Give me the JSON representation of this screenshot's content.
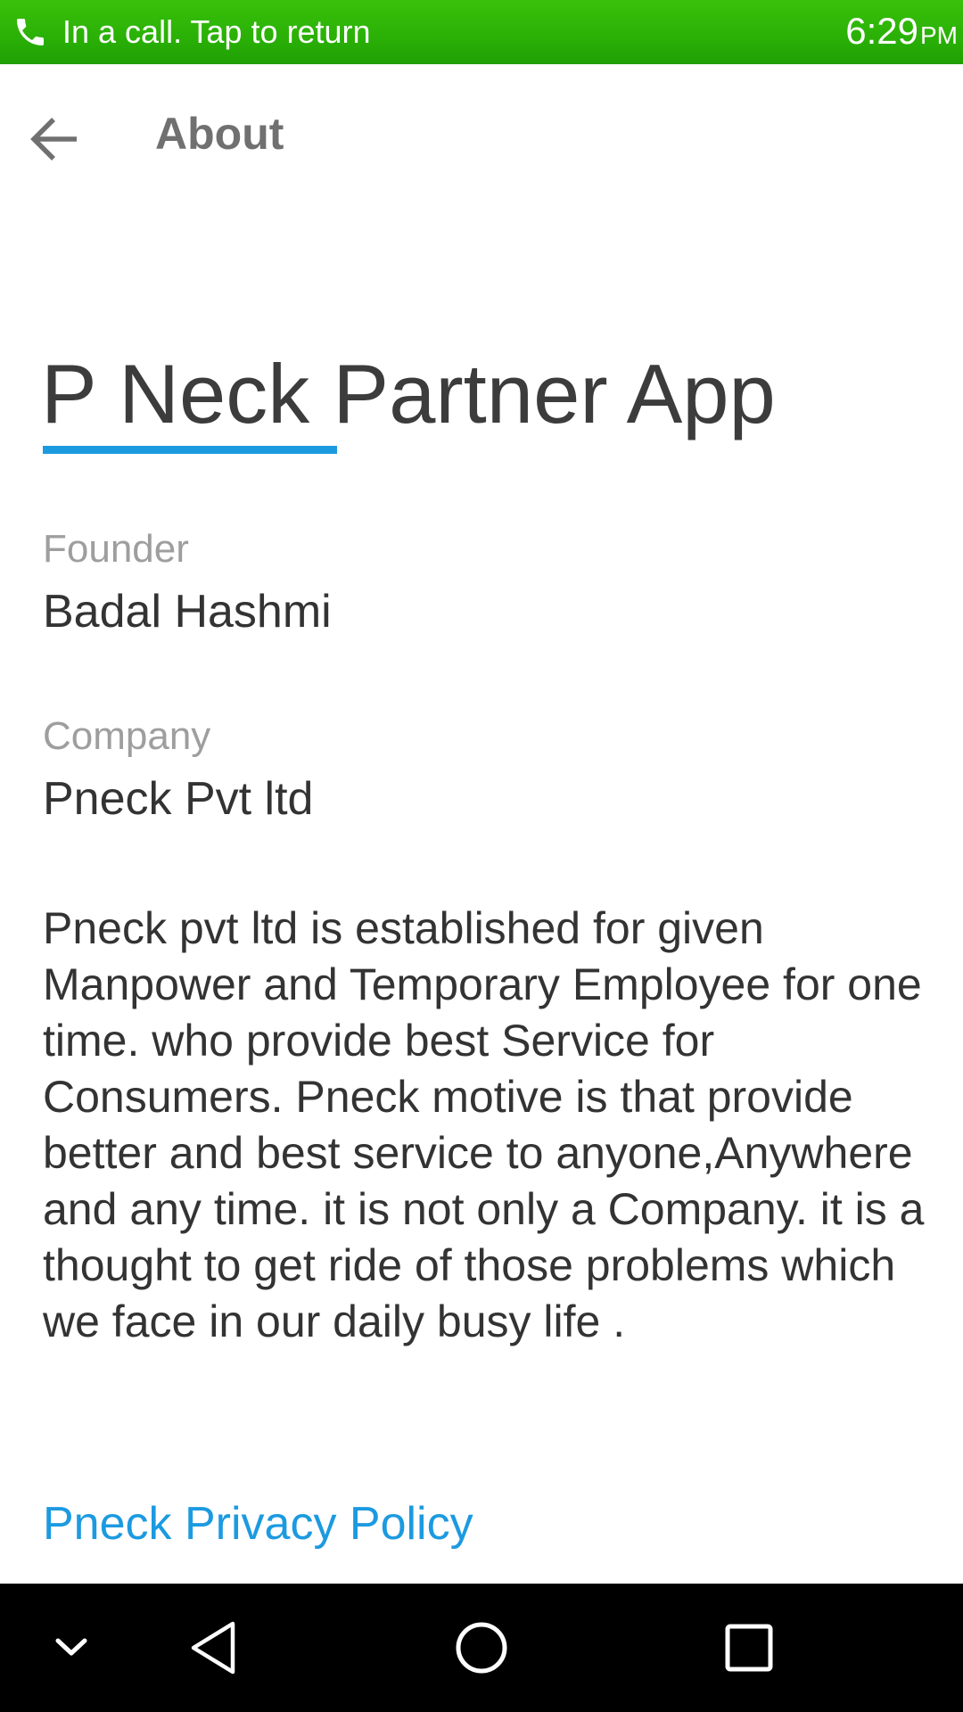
{
  "status_bar": {
    "call_text": "In a call. Tap to return",
    "time": "6:29",
    "ampm": "PM",
    "icon": "phone-icon",
    "color": "#2ab006"
  },
  "app_bar": {
    "back_icon": "arrow-back-icon",
    "title": "About"
  },
  "content": {
    "app_name": "P Neck Partner App",
    "founder_label": "Founder",
    "founder_value": "Badal Hashmi",
    "company_label": "Company",
    "company_value": "Pneck Pvt ltd",
    "description": "Pneck pvt ltd is established for given Manpower and Temporary Employee for one time. who provide best Service for Consumers. Pneck motive is that provide better and best service to anyone,Anywhere and any time. it is not only a Company. it is a thought to get ride of those problems which we face in our daily busy life .",
    "privacy_link": "Pneck Privacy Policy",
    "accent_color": "#1c9ae0"
  },
  "nav_bar": {
    "buttons": [
      "chevron-down-icon",
      "back-triangle-icon",
      "home-circle-icon",
      "recents-square-icon"
    ]
  }
}
